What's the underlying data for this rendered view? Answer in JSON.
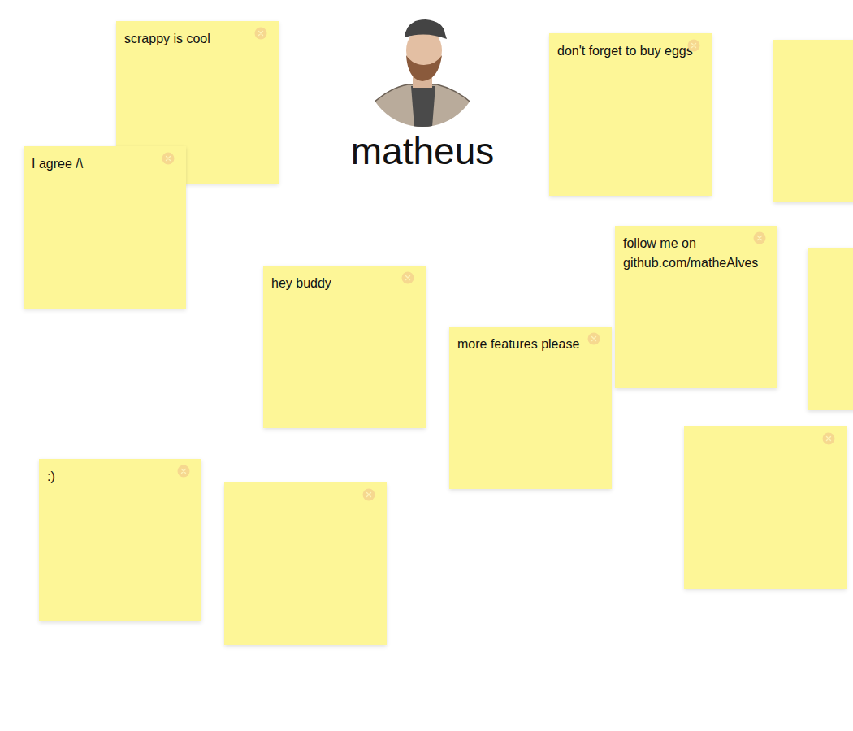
{
  "profile": {
    "name": "matheus"
  },
  "notes": [
    {
      "text": "scrappy is cool"
    },
    {
      "text": "I agree /\\"
    },
    {
      "text": "don't forget to buy eggs"
    },
    {
      "text": ""
    },
    {
      "text": "follow me on github.com/matheAlves"
    },
    {
      "text": ""
    },
    {
      "text": "hey buddy"
    },
    {
      "text": "more features please"
    },
    {
      "text": ""
    },
    {
      "text": ":)"
    },
    {
      "text": ""
    }
  ]
}
